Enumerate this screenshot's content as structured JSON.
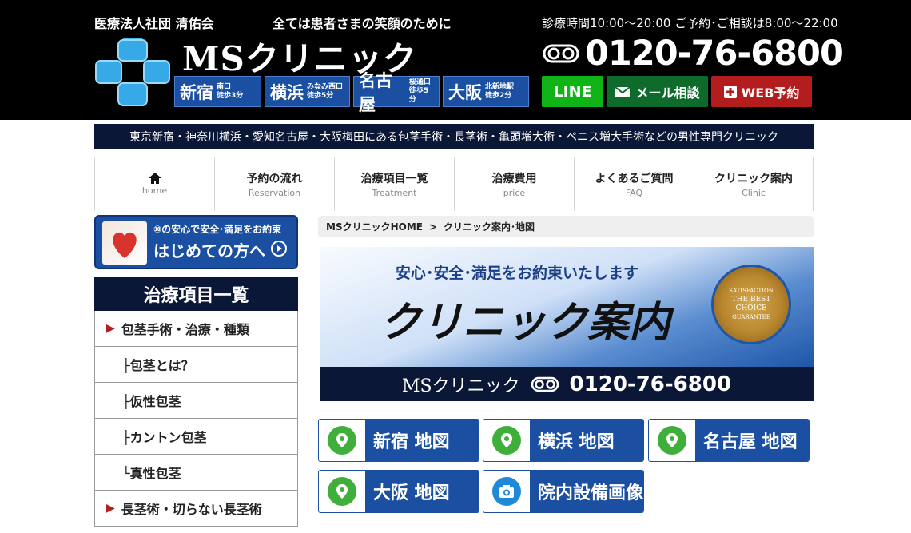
{
  "header": {
    "org": "医療法人社団 清佑会",
    "tagline": "全ては患者さまの笑顔のために",
    "clinic_name": "MSクリニック",
    "hours": "診療時間10:00～20:00 ご予約･ご相談は8:00～22:00",
    "phone": "0120-76-6800",
    "locations": [
      {
        "name": "新宿",
        "sub1": "南口",
        "sub2": "徒歩3分"
      },
      {
        "name": "横浜",
        "sub1": "みなみ西口",
        "sub2": "徒歩5分"
      },
      {
        "name": "名古屋",
        "sub1": "桜通口",
        "sub2": "徒歩5分"
      },
      {
        "name": "大阪",
        "sub1": "北新地駅",
        "sub2": "徒歩2分"
      }
    ],
    "cta_line": "LINE",
    "cta_mail": "メール相談",
    "cta_web": "WEB予約"
  },
  "strip_text": "東京新宿・神奈川横浜・愛知名古屋・大阪梅田にある包茎手術・長茎術・亀頭増大術・ペニス増大手術などの男性専門クリニック",
  "nav": [
    {
      "jp": "",
      "en": "home"
    },
    {
      "jp": "予約の流れ",
      "en": "Reservation"
    },
    {
      "jp": "治療項目一覧",
      "en": "Treatment"
    },
    {
      "jp": "治療費用",
      "en": "price"
    },
    {
      "jp": "よくあるご質問",
      "en": "FAQ"
    },
    {
      "jp": "クリニック案内",
      "en": "Clinic"
    }
  ],
  "sidebar": {
    "first_top": "⑩の安心で安全･満足をお約束",
    "first_main": "はじめての方へ",
    "heading": "治療項目一覧",
    "items": [
      {
        "label": "包茎手術・治療・種類"
      },
      {
        "label": "├包茎とは？"
      },
      {
        "label": "├仮性包茎"
      },
      {
        "label": "├カントン包茎"
      },
      {
        "label": "└真性包茎"
      },
      {
        "label": "長茎術・切らない長茎術"
      }
    ]
  },
  "breadcrumb": {
    "home": "MSクリニックHOME",
    "sep": ">",
    "current": "クリニック案内･地図"
  },
  "hero": {
    "tagline": "安心･安全･満足をお約束いたします",
    "title": "クリニック案内",
    "seal_top": "SATISFACTION",
    "seal_mid1": "THE BEST",
    "seal_mid2": "CHOICE",
    "seal_bottom": "GUARANTEE",
    "clinic": "MSクリニック",
    "phone": "0120-76-6800"
  },
  "maps": [
    {
      "label": "新宿 地図",
      "icon": "map-pin-icon"
    },
    {
      "label": "横浜 地図",
      "icon": "map-pin-icon"
    },
    {
      "label": "名古屋 地図",
      "icon": "map-pin-icon"
    },
    {
      "label": "大阪 地図",
      "icon": "map-pin-icon"
    },
    {
      "label": "院内設備画像",
      "icon": "camera-icon"
    }
  ],
  "colors": {
    "navy": "#0b1736",
    "blue": "#1a4fa1",
    "green": "#11b416",
    "red": "#b31d1d"
  }
}
